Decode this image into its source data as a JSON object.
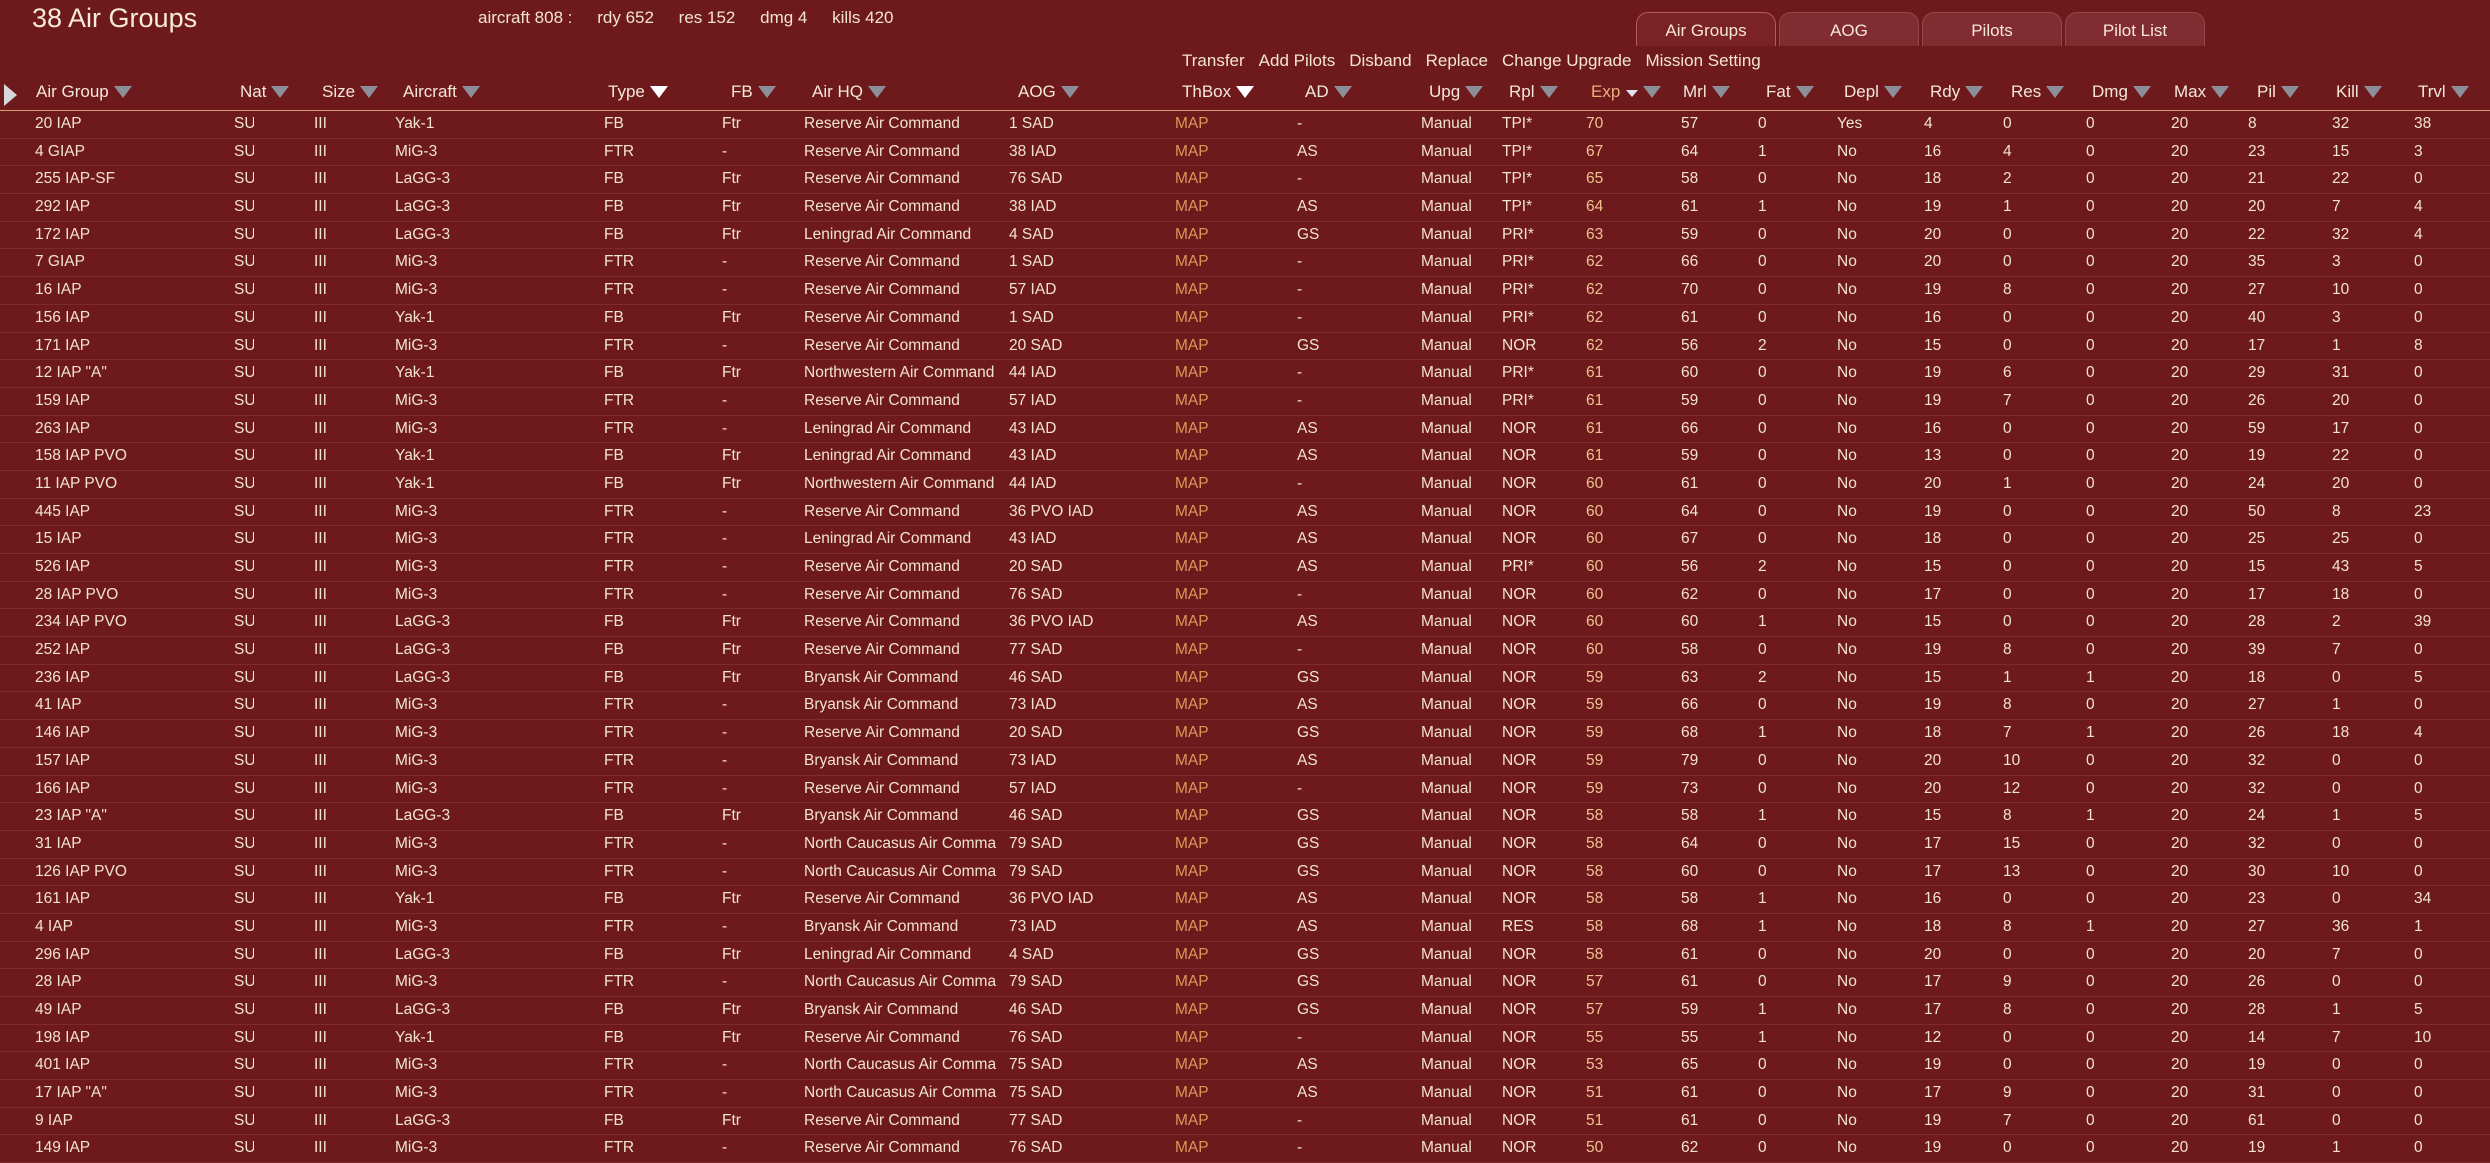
{
  "title": "38 Air Groups",
  "summary": {
    "aircraft": "aircraft 808 :",
    "rdy": "rdy 652",
    "res": "res 152",
    "dmg": "dmg 4",
    "kills": "kills 420"
  },
  "tabs": [
    "Air Groups",
    "AOG",
    "Pilots",
    "Pilot List"
  ],
  "actions": [
    "Transfer",
    "Add Pilots",
    "Disband",
    "Replace",
    "Change Upgrade",
    "Mission Setting"
  ],
  "columns": {
    "air": "Air Group",
    "nat": "Nat",
    "size": "Size",
    "acft": "Aircraft",
    "type": "Type",
    "fb": "FB",
    "hq": "Air HQ",
    "aog": "AOG",
    "thb": "ThBox",
    "ad": "AD",
    "upg": "Upg",
    "rpl": "Rpl",
    "exp": "Exp",
    "mrl": "Mrl",
    "fat": "Fat",
    "depl": "Depl",
    "rdy": "Rdy",
    "res": "Res",
    "dmg": "Dmg",
    "max": "Max",
    "pil": "Pil",
    "kill": "Kill",
    "trvl": "Trvl"
  },
  "sort_column": "Exp",
  "colors": {
    "background": "#6e1a1d",
    "map_link": "#de9657",
    "exp_text": "#f0c390",
    "header_rule": "#d59f70"
  },
  "rows": [
    [
      "20 IAP",
      "SU",
      "III",
      "Yak-1",
      "FB",
      "Ftr",
      "Reserve Air Command",
      "1 SAD",
      "MAP",
      "-",
      "Manual",
      "TPI*",
      "70",
      "57",
      "0",
      "Yes",
      "4",
      "0",
      "0",
      "20",
      "8",
      "32",
      "38"
    ],
    [
      "4 GIAP",
      "SU",
      "III",
      "MiG-3",
      "FTR",
      "-",
      "Reserve Air Command",
      "38 IAD",
      "MAP",
      "AS",
      "Manual",
      "TPI*",
      "67",
      "64",
      "1",
      "No",
      "16",
      "4",
      "0",
      "20",
      "23",
      "15",
      "3"
    ],
    [
      "255 IAP-SF",
      "SU",
      "III",
      "LaGG-3",
      "FB",
      "Ftr",
      "Reserve Air Command",
      "76 SAD",
      "MAP",
      "-",
      "Manual",
      "TPI*",
      "65",
      "58",
      "0",
      "No",
      "18",
      "2",
      "0",
      "20",
      "21",
      "22",
      "0"
    ],
    [
      "292 IAP",
      "SU",
      "III",
      "LaGG-3",
      "FB",
      "Ftr",
      "Reserve Air Command",
      "38 IAD",
      "MAP",
      "AS",
      "Manual",
      "TPI*",
      "64",
      "61",
      "1",
      "No",
      "19",
      "1",
      "0",
      "20",
      "20",
      "7",
      "4"
    ],
    [
      "172 IAP",
      "SU",
      "III",
      "LaGG-3",
      "FB",
      "Ftr",
      "Leningrad Air Command",
      "4 SAD",
      "MAP",
      "GS",
      "Manual",
      "PRI*",
      "63",
      "59",
      "0",
      "No",
      "20",
      "0",
      "0",
      "20",
      "22",
      "32",
      "4"
    ],
    [
      "7 GIAP",
      "SU",
      "III",
      "MiG-3",
      "FTR",
      "-",
      "Reserve Air Command",
      "1 SAD",
      "MAP",
      "-",
      "Manual",
      "PRI*",
      "62",
      "66",
      "0",
      "No",
      "20",
      "0",
      "0",
      "20",
      "35",
      "3",
      "0"
    ],
    [
      "16 IAP",
      "SU",
      "III",
      "MiG-3",
      "FTR",
      "-",
      "Reserve Air Command",
      "57 IAD",
      "MAP",
      "-",
      "Manual",
      "PRI*",
      "62",
      "70",
      "0",
      "No",
      "19",
      "8",
      "0",
      "20",
      "27",
      "10",
      "0"
    ],
    [
      "156 IAP",
      "SU",
      "III",
      "Yak-1",
      "FB",
      "Ftr",
      "Reserve Air Command",
      "1 SAD",
      "MAP",
      "-",
      "Manual",
      "PRI*",
      "62",
      "61",
      "0",
      "No",
      "16",
      "0",
      "0",
      "20",
      "40",
      "3",
      "0"
    ],
    [
      "171 IAP",
      "SU",
      "III",
      "MiG-3",
      "FTR",
      "-",
      "Reserve Air Command",
      "20 SAD",
      "MAP",
      "GS",
      "Manual",
      "NOR",
      "62",
      "56",
      "2",
      "No",
      "15",
      "0",
      "0",
      "20",
      "17",
      "1",
      "8"
    ],
    [
      "12 IAP \"A\"",
      "SU",
      "III",
      "Yak-1",
      "FB",
      "Ftr",
      "Northwestern Air Command",
      "44 IAD",
      "MAP",
      "-",
      "Manual",
      "PRI*",
      "61",
      "60",
      "0",
      "No",
      "19",
      "6",
      "0",
      "20",
      "29",
      "31",
      "0"
    ],
    [
      "159 IAP",
      "SU",
      "III",
      "MiG-3",
      "FTR",
      "-",
      "Reserve Air Command",
      "57 IAD",
      "MAP",
      "-",
      "Manual",
      "PRI*",
      "61",
      "59",
      "0",
      "No",
      "19",
      "7",
      "0",
      "20",
      "26",
      "20",
      "0"
    ],
    [
      "263 IAP",
      "SU",
      "III",
      "MiG-3",
      "FTR",
      "-",
      "Leningrad Air Command",
      "43 IAD",
      "MAP",
      "AS",
      "Manual",
      "NOR",
      "61",
      "66",
      "0",
      "No",
      "16",
      "0",
      "0",
      "20",
      "59",
      "17",
      "0"
    ],
    [
      "158 IAP PVO",
      "SU",
      "III",
      "Yak-1",
      "FB",
      "Ftr",
      "Leningrad Air Command",
      "43 IAD",
      "MAP",
      "AS",
      "Manual",
      "NOR",
      "61",
      "59",
      "0",
      "No",
      "13",
      "0",
      "0",
      "20",
      "19",
      "22",
      "0"
    ],
    [
      "11 IAP PVO",
      "SU",
      "III",
      "Yak-1",
      "FB",
      "Ftr",
      "Northwestern Air Command",
      "44 IAD",
      "MAP",
      "-",
      "Manual",
      "NOR",
      "60",
      "61",
      "0",
      "No",
      "20",
      "1",
      "0",
      "20",
      "24",
      "20",
      "0"
    ],
    [
      "445 IAP",
      "SU",
      "III",
      "MiG-3",
      "FTR",
      "-",
      "Reserve Air Command",
      "36 PVO IAD",
      "MAP",
      "AS",
      "Manual",
      "NOR",
      "60",
      "64",
      "0",
      "No",
      "19",
      "0",
      "0",
      "20",
      "50",
      "8",
      "23"
    ],
    [
      "15 IAP",
      "SU",
      "III",
      "MiG-3",
      "FTR",
      "-",
      "Leningrad Air Command",
      "43 IAD",
      "MAP",
      "AS",
      "Manual",
      "NOR",
      "60",
      "67",
      "0",
      "No",
      "18",
      "0",
      "0",
      "20",
      "25",
      "25",
      "0"
    ],
    [
      "526 IAP",
      "SU",
      "III",
      "MiG-3",
      "FTR",
      "-",
      "Reserve Air Command",
      "20 SAD",
      "MAP",
      "AS",
      "Manual",
      "PRI*",
      "60",
      "56",
      "2",
      "No",
      "15",
      "0",
      "0",
      "20",
      "15",
      "43",
      "5"
    ],
    [
      "28 IAP PVO",
      "SU",
      "III",
      "MiG-3",
      "FTR",
      "-",
      "Reserve Air Command",
      "76 SAD",
      "MAP",
      "-",
      "Manual",
      "NOR",
      "60",
      "62",
      "0",
      "No",
      "17",
      "0",
      "0",
      "20",
      "17",
      "18",
      "0"
    ],
    [
      "234 IAP PVO",
      "SU",
      "III",
      "LaGG-3",
      "FB",
      "Ftr",
      "Reserve Air Command",
      "36 PVO IAD",
      "MAP",
      "AS",
      "Manual",
      "NOR",
      "60",
      "60",
      "1",
      "No",
      "15",
      "0",
      "0",
      "20",
      "28",
      "2",
      "39"
    ],
    [
      "252 IAP",
      "SU",
      "III",
      "LaGG-3",
      "FB",
      "Ftr",
      "Reserve Air Command",
      "77 SAD",
      "MAP",
      "-",
      "Manual",
      "NOR",
      "60",
      "58",
      "0",
      "No",
      "19",
      "8",
      "0",
      "20",
      "39",
      "7",
      "0"
    ],
    [
      "236 IAP",
      "SU",
      "III",
      "LaGG-3",
      "FB",
      "Ftr",
      "Bryansk Air Command",
      "46 SAD",
      "MAP",
      "GS",
      "Manual",
      "NOR",
      "59",
      "63",
      "2",
      "No",
      "15",
      "1",
      "1",
      "20",
      "18",
      "0",
      "5"
    ],
    [
      "41 IAP",
      "SU",
      "III",
      "MiG-3",
      "FTR",
      "-",
      "Bryansk Air Command",
      "73 IAD",
      "MAP",
      "AS",
      "Manual",
      "NOR",
      "59",
      "66",
      "0",
      "No",
      "19",
      "8",
      "0",
      "20",
      "27",
      "1",
      "0"
    ],
    [
      "146 IAP",
      "SU",
      "III",
      "MiG-3",
      "FTR",
      "-",
      "Reserve Air Command",
      "20 SAD",
      "MAP",
      "GS",
      "Manual",
      "NOR",
      "59",
      "68",
      "1",
      "No",
      "18",
      "7",
      "1",
      "20",
      "26",
      "18",
      "4"
    ],
    [
      "157 IAP",
      "SU",
      "III",
      "MiG-3",
      "FTR",
      "-",
      "Bryansk Air Command",
      "73 IAD",
      "MAP",
      "AS",
      "Manual",
      "NOR",
      "59",
      "79",
      "0",
      "No",
      "20",
      "10",
      "0",
      "20",
      "32",
      "0",
      "0"
    ],
    [
      "166 IAP",
      "SU",
      "III",
      "MiG-3",
      "FTR",
      "-",
      "Reserve Air Command",
      "57 IAD",
      "MAP",
      "-",
      "Manual",
      "NOR",
      "59",
      "73",
      "0",
      "No",
      "20",
      "12",
      "0",
      "20",
      "32",
      "0",
      "0"
    ],
    [
      "23 IAP \"A\"",
      "SU",
      "III",
      "LaGG-3",
      "FB",
      "Ftr",
      "Bryansk Air Command",
      "46 SAD",
      "MAP",
      "GS",
      "Manual",
      "NOR",
      "58",
      "58",
      "1",
      "No",
      "15",
      "8",
      "1",
      "20",
      "24",
      "1",
      "5"
    ],
    [
      "31 IAP",
      "SU",
      "III",
      "MiG-3",
      "FTR",
      "-",
      "North Caucasus Air Comma",
      "79 SAD",
      "MAP",
      "GS",
      "Manual",
      "NOR",
      "58",
      "64",
      "0",
      "No",
      "17",
      "15",
      "0",
      "20",
      "32",
      "0",
      "0"
    ],
    [
      "126 IAP PVO",
      "SU",
      "III",
      "MiG-3",
      "FTR",
      "-",
      "North Caucasus Air Comma",
      "79 SAD",
      "MAP",
      "GS",
      "Manual",
      "NOR",
      "58",
      "60",
      "0",
      "No",
      "17",
      "13",
      "0",
      "20",
      "30",
      "10",
      "0"
    ],
    [
      "161 IAP",
      "SU",
      "III",
      "Yak-1",
      "FB",
      "Ftr",
      "Reserve Air Command",
      "36 PVO IAD",
      "MAP",
      "AS",
      "Manual",
      "NOR",
      "58",
      "58",
      "1",
      "No",
      "16",
      "0",
      "0",
      "20",
      "23",
      "0",
      "34"
    ],
    [
      "4 IAP",
      "SU",
      "III",
      "MiG-3",
      "FTR",
      "-",
      "Bryansk Air Command",
      "73 IAD",
      "MAP",
      "AS",
      "Manual",
      "RES",
      "58",
      "68",
      "1",
      "No",
      "18",
      "8",
      "1",
      "20",
      "27",
      "36",
      "1"
    ],
    [
      "296 IAP",
      "SU",
      "III",
      "LaGG-3",
      "FB",
      "Ftr",
      "Leningrad Air Command",
      "4 SAD",
      "MAP",
      "GS",
      "Manual",
      "NOR",
      "58",
      "61",
      "0",
      "No",
      "20",
      "0",
      "0",
      "20",
      "20",
      "7",
      "0"
    ],
    [
      "28 IAP",
      "SU",
      "III",
      "MiG-3",
      "FTR",
      "-",
      "North Caucasus Air Comma",
      "79 SAD",
      "MAP",
      "GS",
      "Manual",
      "NOR",
      "57",
      "61",
      "0",
      "No",
      "17",
      "9",
      "0",
      "20",
      "26",
      "0",
      "0"
    ],
    [
      "49 IAP",
      "SU",
      "III",
      "LaGG-3",
      "FB",
      "Ftr",
      "Bryansk Air Command",
      "46 SAD",
      "MAP",
      "GS",
      "Manual",
      "NOR",
      "57",
      "59",
      "1",
      "No",
      "17",
      "8",
      "0",
      "20",
      "28",
      "1",
      "5"
    ],
    [
      "198 IAP",
      "SU",
      "III",
      "Yak-1",
      "FB",
      "Ftr",
      "Reserve Air Command",
      "76 SAD",
      "MAP",
      "-",
      "Manual",
      "NOR",
      "55",
      "55",
      "1",
      "No",
      "12",
      "0",
      "0",
      "20",
      "14",
      "7",
      "10"
    ],
    [
      "401 IAP",
      "SU",
      "III",
      "MiG-3",
      "FTR",
      "-",
      "North Caucasus Air Comma",
      "75 SAD",
      "MAP",
      "AS",
      "Manual",
      "NOR",
      "53",
      "65",
      "0",
      "No",
      "19",
      "0",
      "0",
      "20",
      "19",
      "0",
      "0"
    ],
    [
      "17 IAP \"A\"",
      "SU",
      "III",
      "MiG-3",
      "FTR",
      "-",
      "North Caucasus Air Comma",
      "75 SAD",
      "MAP",
      "AS",
      "Manual",
      "NOR",
      "51",
      "61",
      "0",
      "No",
      "17",
      "9",
      "0",
      "20",
      "31",
      "0",
      "0"
    ],
    [
      "9 IAP",
      "SU",
      "III",
      "LaGG-3",
      "FB",
      "Ftr",
      "Reserve Air Command",
      "77 SAD",
      "MAP",
      "-",
      "Manual",
      "NOR",
      "51",
      "61",
      "0",
      "No",
      "19",
      "7",
      "0",
      "20",
      "61",
      "0",
      "0"
    ],
    [
      "149 IAP",
      "SU",
      "III",
      "MiG-3",
      "FTR",
      "-",
      "Reserve Air Command",
      "76 SAD",
      "MAP",
      "-",
      "Manual",
      "NOR",
      "50",
      "62",
      "0",
      "No",
      "19",
      "0",
      "0",
      "20",
      "19",
      "1",
      "0"
    ]
  ]
}
